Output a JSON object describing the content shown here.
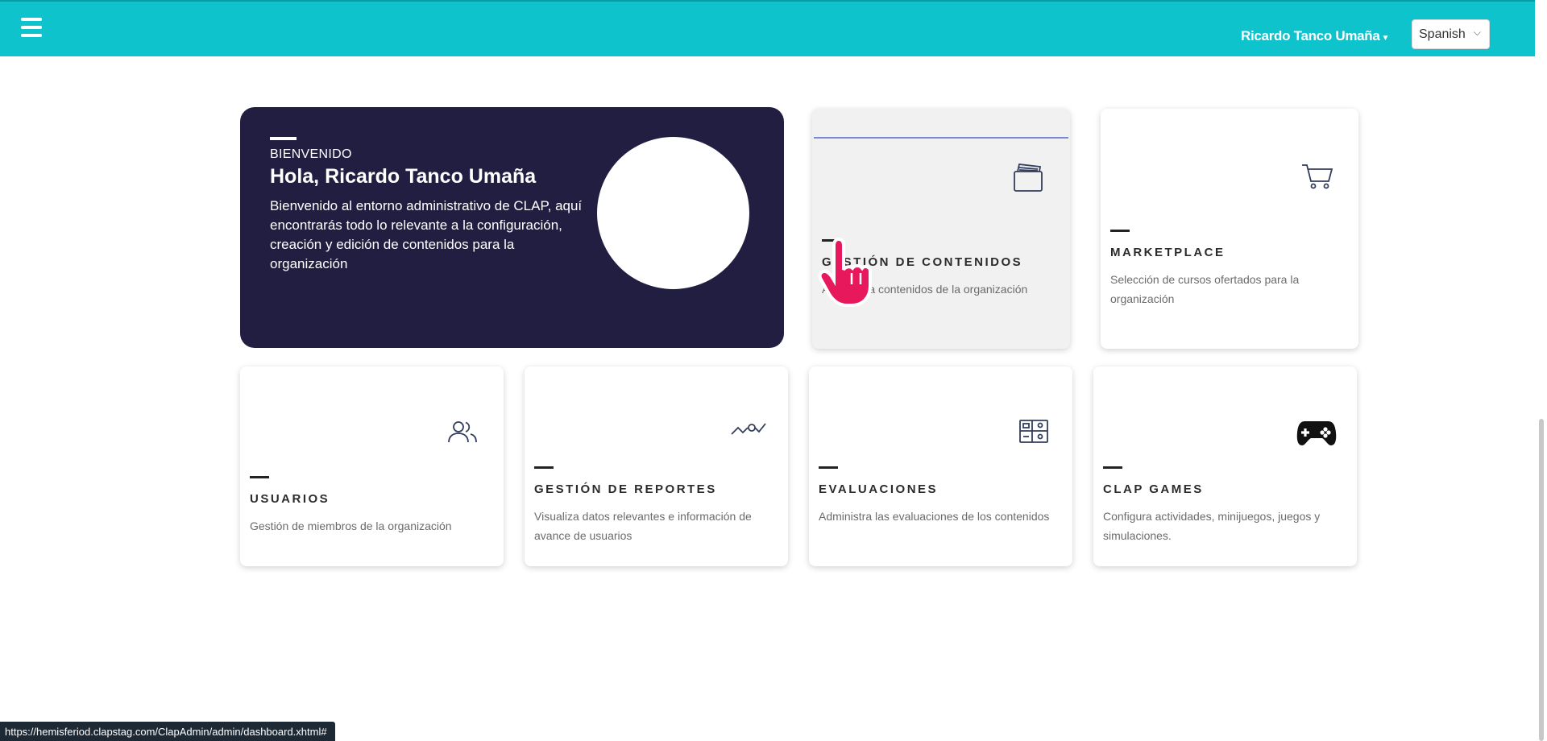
{
  "header": {
    "menu_icon": "hamburger-icon",
    "user_name": "Ricardo Tanco Umaña",
    "language": "Spanish"
  },
  "welcome": {
    "eyebrow": "BIENVENIDO",
    "greeting": "Hola, Ricardo Tanco Umaña",
    "description": "Bienvenido al entorno administrativo de CLAP, aquí encontrarás todo lo relevante a la configuración, creación y edición de contenidos para la organización"
  },
  "cards": [
    {
      "id": "contenidos",
      "icon": "folder-icon",
      "title": "GESTIÓN DE CONTENIDOS",
      "text": "Administra contenidos de la organización"
    },
    {
      "id": "marketplace",
      "icon": "cart-icon",
      "title": "MARKETPLACE",
      "text": "Selección de cursos ofertados para la organización"
    },
    {
      "id": "usuarios",
      "icon": "users-icon",
      "title": "USUARIOS",
      "text": "Gestión de miembros de la organización"
    },
    {
      "id": "reportes",
      "icon": "chart-icon",
      "title": "GESTIÓN DE REPORTES",
      "text": "Visualiza datos relevantes e información de avance de usuarios"
    },
    {
      "id": "evaluaciones",
      "icon": "evaluation-icon",
      "title": "EVALUACIONES",
      "text": "Administra las evaluaciones de los contenidos"
    },
    {
      "id": "games",
      "icon": "gamepad-icon",
      "title": "CLAP GAMES",
      "text": "Configura actividades, minijuegos, juegos y simulaciones."
    }
  ],
  "status_url": "https://hemisferiod.clapstag.com/ClapAdmin/admin/dashboard.xhtml#",
  "colors": {
    "topbar": "#0ec3cc",
    "welcome_bg": "#221e41",
    "accent_line": "#7b86d4",
    "cursor": "#e8185d"
  }
}
